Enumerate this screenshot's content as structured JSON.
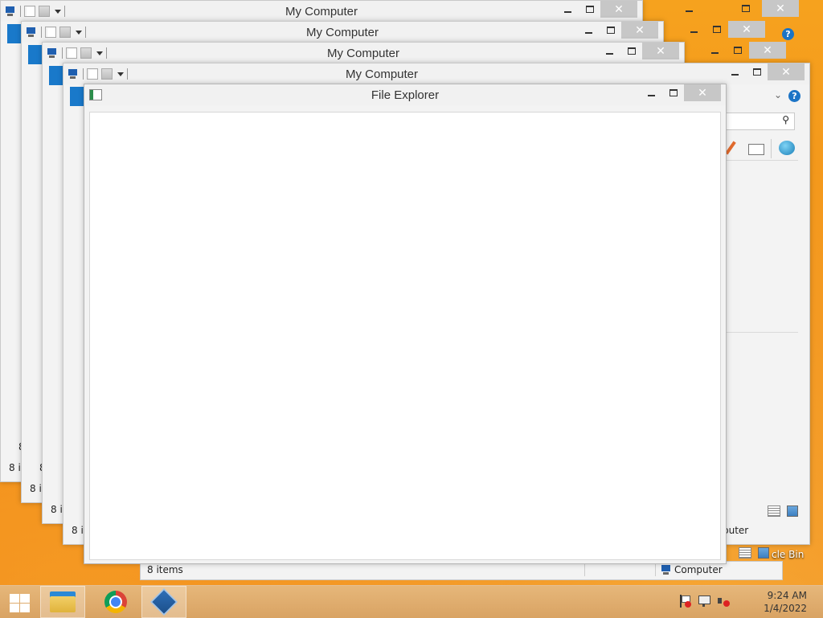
{
  "windows": {
    "back_title": "My Computer",
    "front_title": "File Explorer",
    "status_items": "8 items",
    "status_items_partial": "8 it",
    "status_eight": "8",
    "status_computer": "Computer",
    "status_computer_partial": "puter",
    "search_partial": "r",
    "close_glyph": "✕",
    "help_glyph": "?"
  },
  "front": {
    "address_value": "",
    "search_value": ""
  },
  "desktop": {
    "recycle_label_partial": "cle Bin"
  },
  "taskbar": {
    "apps": [
      "file-explorer",
      "chrome",
      "virtualbox"
    ]
  },
  "clock": {
    "time": "9:24 AM",
    "date": "1/4/2022"
  },
  "colors": {
    "accent_blue": "#1979ca",
    "desktop_orange": "#f3931a",
    "close_grey": "#c7c7c7"
  }
}
